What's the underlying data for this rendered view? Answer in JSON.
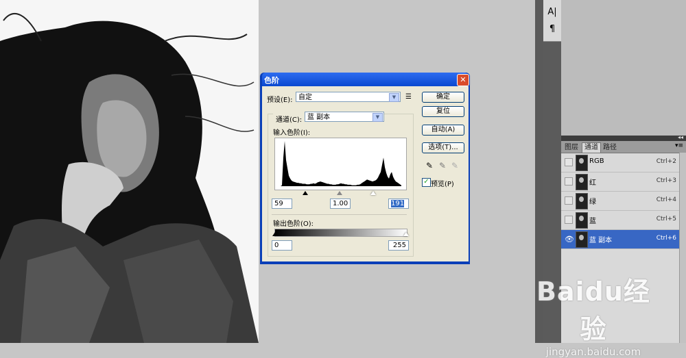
{
  "dialog": {
    "title": "色阶",
    "close": "✕",
    "preset_label": "预设(E):",
    "preset_value": "自定",
    "channel_label": "通道(C):",
    "channel_value": "蓝 副本",
    "input_levels_label": "输入色阶(I):",
    "input_black": "59",
    "input_gamma": "1.00",
    "input_white": "191",
    "output_levels_label": "输出色阶(O):",
    "output_black": "0",
    "output_white": "255",
    "buttons": {
      "ok": "确定",
      "reset": "复位",
      "auto": "自动(A)",
      "options": "选项(T)..."
    },
    "preview_label": "预览(P)",
    "preview_checked": true,
    "histogram": [
      0,
      0,
      2,
      60,
      95,
      55,
      38,
      22,
      16,
      12,
      10,
      9,
      8,
      7,
      7,
      6,
      6,
      5,
      5,
      5,
      4,
      4,
      4,
      5,
      5,
      6,
      5,
      6,
      8,
      9,
      10,
      9,
      8,
      7,
      6,
      5,
      5,
      4,
      4,
      3,
      3,
      3,
      4,
      4,
      5,
      6,
      5,
      5,
      4,
      4,
      3,
      3,
      3,
      2,
      2,
      2,
      2,
      3,
      3,
      4,
      6,
      8,
      10,
      12,
      14,
      13,
      12,
      11,
      10,
      11,
      12,
      14,
      18,
      24,
      30,
      45,
      60,
      40,
      28,
      20,
      16,
      25,
      30,
      20,
      14,
      10,
      8,
      6,
      4,
      2
    ]
  },
  "tools": {
    "type": "A|",
    "paragraph": "¶"
  },
  "channels_panel": {
    "tabs": [
      "图层",
      "通道",
      "路径"
    ],
    "active_tab": 1,
    "rows": [
      {
        "name": "RGB",
        "key": "Ctrl+2",
        "visible": false,
        "selected": false
      },
      {
        "name": "红",
        "key": "Ctrl+3",
        "visible": false,
        "selected": false
      },
      {
        "name": "绿",
        "key": "Ctrl+4",
        "visible": false,
        "selected": false
      },
      {
        "name": "蓝",
        "key": "Ctrl+5",
        "visible": false,
        "selected": false
      },
      {
        "name": "蓝 副本",
        "key": "Ctrl+6",
        "visible": true,
        "selected": true
      }
    ]
  },
  "watermark": {
    "brand": "Baidu经验",
    "url": "jingyan.baidu.com"
  },
  "colors": {
    "selection": "#3867c4",
    "titlebar": "#0b49d0"
  }
}
